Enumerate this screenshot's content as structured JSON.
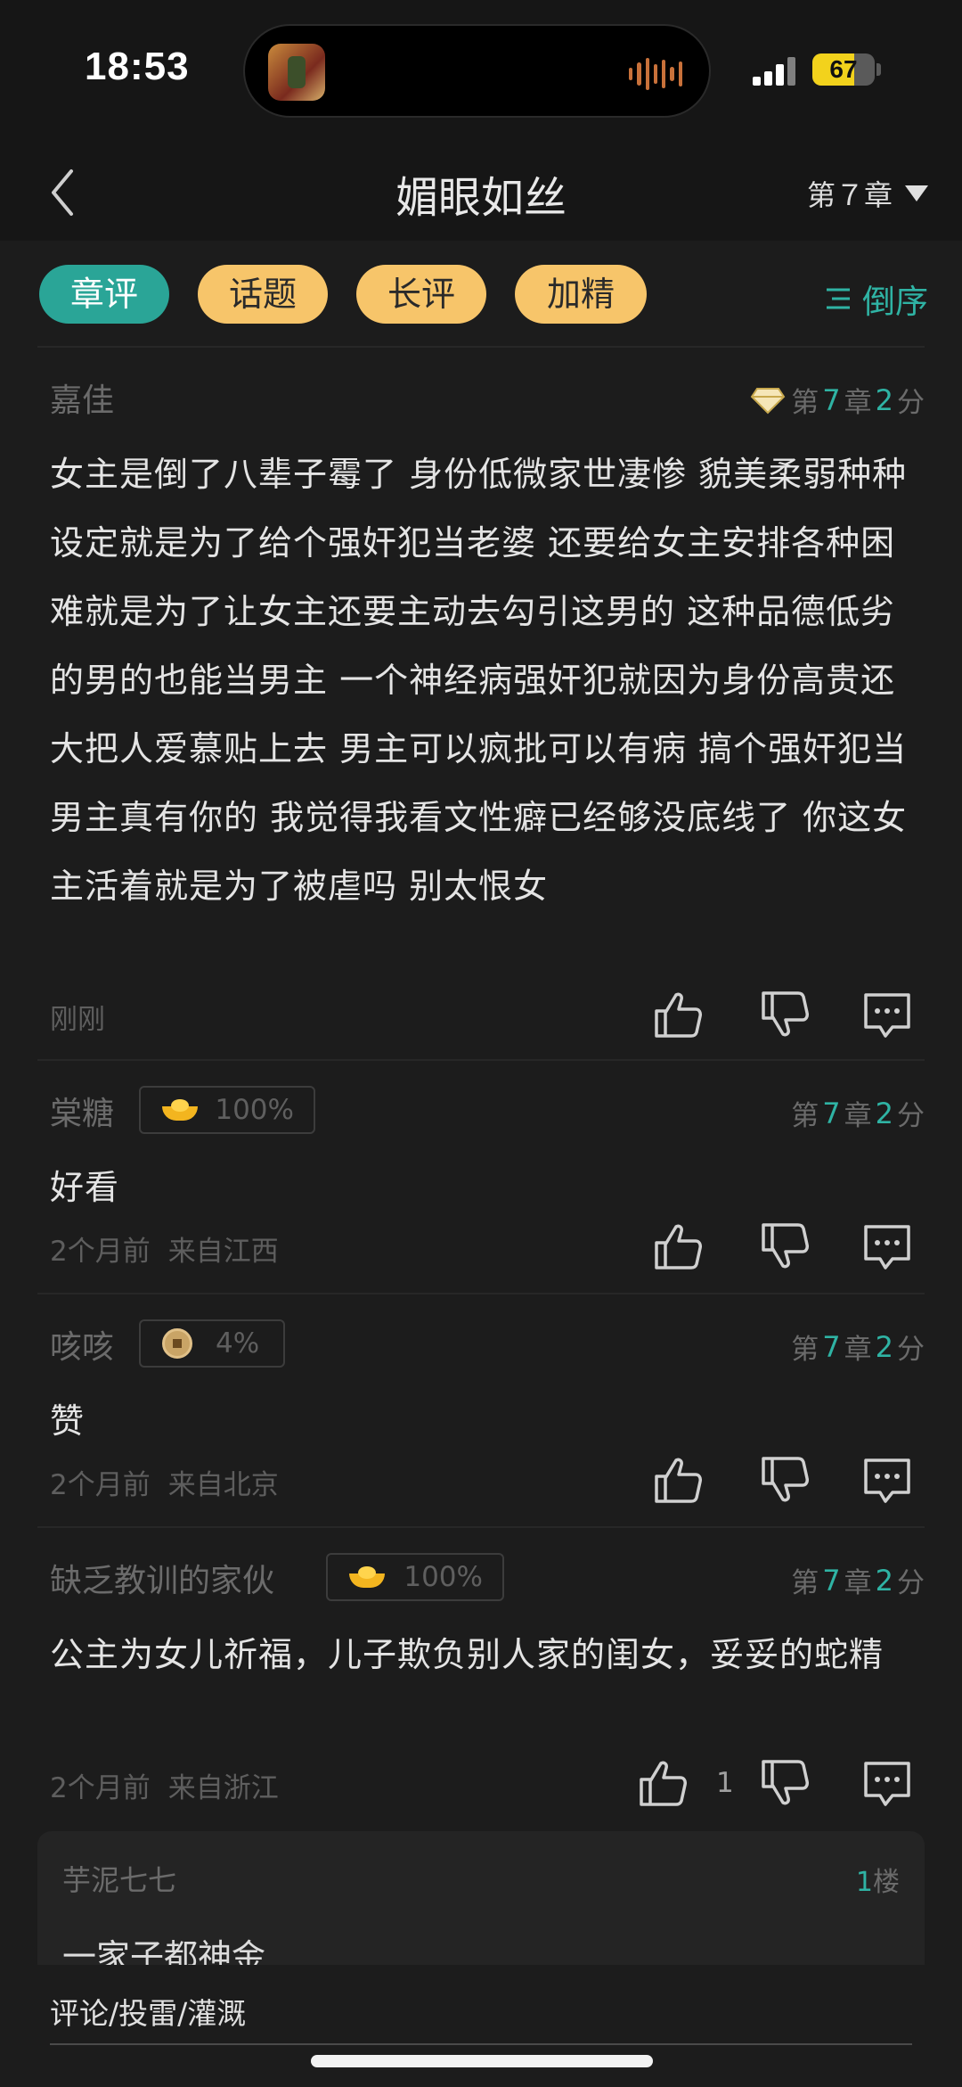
{
  "status_bar": {
    "time": "18:53",
    "battery": "67",
    "battery_level": 0.67
  },
  "nav": {
    "title": "媚眼如丝",
    "chapter": "第７章"
  },
  "filters": {
    "chips": [
      "章评",
      "话题",
      "长评",
      "加精"
    ],
    "active": "章评",
    "sort_label": "倒序"
  },
  "comments": [
    {
      "name": "嘉佳",
      "badge": null,
      "meta_prefix": "第",
      "chapter": "7",
      "meta_mid": "章",
      "score": "2",
      "meta_suffix": "分",
      "body": "女主是倒了八辈子霉了 身份低微家世凄惨 貌美柔弱种种设定就是为了给个强奸犯当老婆 还要给女主安排各种困难就是为了让女主还要主动去勾引这男的 这种品德低劣的男的也能当男主 一个神经病强奸犯就因为身份高贵还大把人爱慕贴上去 男主可以疯批可以有病 搞个强奸犯当男主真有你的 我觉得我看文性癖已经够没底线了 你这女主活着就是为了被虐吗 别太恨女",
      "time": "刚刚",
      "location": ""
    },
    {
      "name": "棠糖",
      "badge": "100%",
      "meta_prefix": "第",
      "chapter": "7",
      "meta_mid": "章",
      "score": "2",
      "meta_suffix": "分",
      "body": "好看",
      "time": "2个月前",
      "location": "来自江西"
    },
    {
      "name": "咳咳",
      "badge": "4%",
      "meta_prefix": "第",
      "chapter": "7",
      "meta_mid": "章",
      "score": "2",
      "meta_suffix": "分",
      "body": "赞",
      "time": "2个月前",
      "location": "来自北京"
    },
    {
      "name": "缺乏教训的家伙",
      "badge": "100%",
      "meta_prefix": "第",
      "chapter": "7",
      "meta_mid": "章",
      "score": "2",
      "meta_suffix": "分",
      "body": "公主为女儿祈福，儿子欺负别人家的闺女，妥妥的蛇精",
      "time": "2个月前",
      "location": "来自浙江",
      "likes": "1"
    }
  ],
  "reply": {
    "name": "芋泥七七",
    "floor_num": "1",
    "floor_label": "楼",
    "text": "一家子都神金"
  },
  "bottom": {
    "placeholder": "评论/投雷/灌溉"
  },
  "colors": {
    "accent": "#2aa597",
    "chip": "#f7c56a",
    "background": "#1c1c1c"
  }
}
